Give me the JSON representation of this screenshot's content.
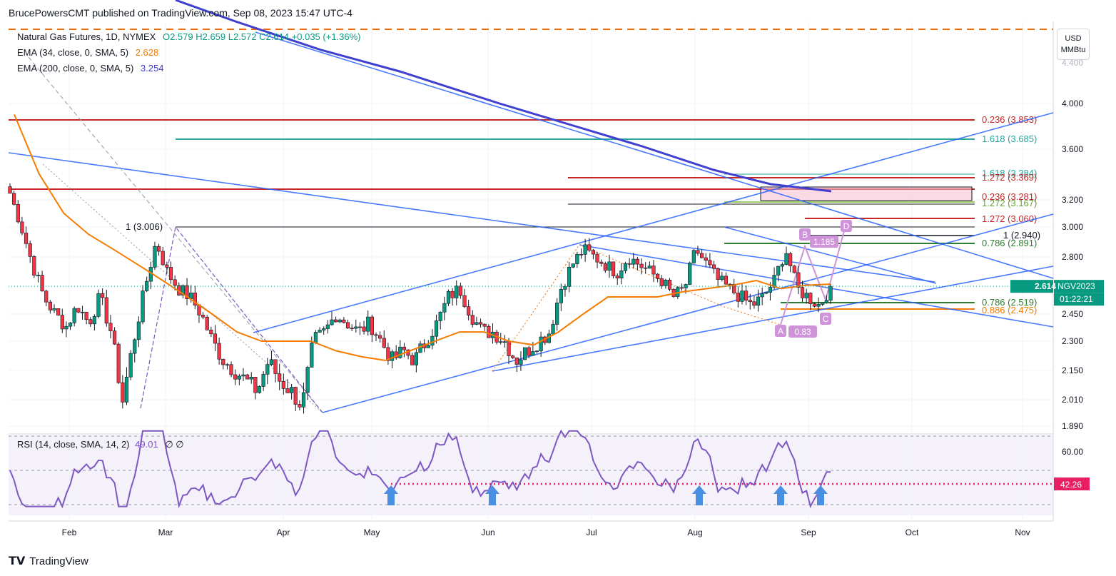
{
  "header": {
    "publisher": "BrucePowersCMT published on TradingView.com, Sep 08, 2023 15:47 UTC-4"
  },
  "legend": {
    "symbol": "Natural Gas Futures, 1D, NYMEX",
    "ohlc": "O2.579  H2.659  L2.572  C2.614  +0.035 (+1.36%)",
    "ema34_label": "EMA (34, close, 0, SMA, 5)",
    "ema34_value": "2.628",
    "ema200_label": "EMA (200, close, 0, SMA, 5)",
    "ema200_value": "3.254"
  },
  "price_axis": {
    "unit_line1": "USD",
    "unit_line2": "MMBtu",
    "ticks": [
      "4.000",
      "3.600",
      "3.200",
      "3.000",
      "2.800",
      "2.450",
      "2.300",
      "2.150",
      "2.010",
      "1.890"
    ],
    "current_symbol": "NGV2023",
    "current_price": "2.614",
    "countdown": "01:22:21"
  },
  "rsi": {
    "label": "RSI (14, close, SMA, 14, 2)",
    "value": "49.01",
    "extra": "∅  ∅",
    "axis_tick": "60.00",
    "level_label": "42.26"
  },
  "time_axis": {
    "labels": [
      "Feb",
      "Mar",
      "Apr",
      "May",
      "Jun",
      "Jul",
      "Aug",
      "Sep",
      "Oct",
      "Nov"
    ]
  },
  "annotations": {
    "fib_labels": [
      {
        "text": "0.236 (3.853)",
        "color": "#c62828"
      },
      {
        "text": "1.618 (3.685)",
        "color": "#26a69a"
      },
      {
        "text": "1.618 (3.384)",
        "color": "#26a69a"
      },
      {
        "text": "1.272 (3.369)",
        "color": "#c62828"
      },
      {
        "text": "0.236 (3.281)",
        "color": "#c62828"
      },
      {
        "text": "1.272 (3.167)",
        "color": "#689f38"
      },
      {
        "text": "1.272 (3.060)",
        "color": "#c62828"
      },
      {
        "text": "1 (2.940)",
        "color": "#131722"
      },
      {
        "text": "0.786 (2.891)",
        "color": "#2e7d32"
      },
      {
        "text": "0.786 (2.519)",
        "color": "#2e7d32"
      },
      {
        "text": "0.886 (2.475)",
        "color": "#f57c00"
      },
      {
        "text": "1 (3.006)",
        "color": "#131722"
      }
    ],
    "pattern_points": [
      "A",
      "B",
      "C",
      "D"
    ],
    "ratios": [
      "1.185",
      "0.83"
    ]
  },
  "footer": {
    "brand": "TradingView"
  },
  "chart_data": {
    "type": "candlestick",
    "title": "Natural Gas Futures, 1D, NYMEX",
    "x_months": [
      "Feb",
      "Mar",
      "Apr",
      "May",
      "Jun",
      "Jul",
      "Aug",
      "Sep",
      "Oct",
      "Nov"
    ],
    "ylim": [
      1.89,
      4.4
    ],
    "y_scale": "log",
    "close_path": [
      3.25,
      3.0,
      2.75,
      2.55,
      2.45,
      2.38,
      2.5,
      2.4,
      2.55,
      2.35,
      2.0,
      2.3,
      2.6,
      2.9,
      2.7,
      2.6,
      2.55,
      2.45,
      2.3,
      2.2,
      2.15,
      2.1,
      2.05,
      2.2,
      2.1,
      2.05,
      1.98,
      2.3,
      2.35,
      2.45,
      2.4,
      2.35,
      2.4,
      2.3,
      2.2,
      2.25,
      2.2,
      2.3,
      2.4,
      2.55,
      2.6,
      2.45,
      2.35,
      2.35,
      2.3,
      2.2,
      2.25,
      2.3,
      2.35,
      2.6,
      2.75,
      2.85,
      2.8,
      2.75,
      2.7,
      2.8,
      2.75,
      2.7,
      2.65,
      2.55,
      2.6,
      2.85,
      2.75,
      2.65,
      2.6,
      2.55,
      2.5,
      2.55,
      2.65,
      2.85,
      2.6,
      2.55,
      2.5,
      2.614
    ],
    "ema34": [
      3.9,
      3.4,
      3.1,
      2.95,
      2.85,
      2.75,
      2.65,
      2.55,
      2.45,
      2.35,
      2.3,
      2.3,
      2.3,
      2.25,
      2.22,
      2.2,
      2.25,
      2.3,
      2.35,
      2.35,
      2.3,
      2.28,
      2.35,
      2.45,
      2.55,
      2.55,
      2.55,
      2.58,
      2.6,
      2.62,
      2.65,
      2.6,
      2.62,
      2.628
    ],
    "ema200": [
      4.35,
      4.2,
      4.05,
      3.9,
      3.75,
      3.6,
      3.45,
      3.35,
      3.28,
      3.254
    ],
    "current_price": 2.614,
    "rsi_value": 49.01,
    "rsi_level": 42.26,
    "fib_levels": [
      3.853,
      3.685,
      3.384,
      3.369,
      3.281,
      3.167,
      3.06,
      2.94,
      2.891,
      2.519,
      2.475,
      3.006
    ]
  }
}
